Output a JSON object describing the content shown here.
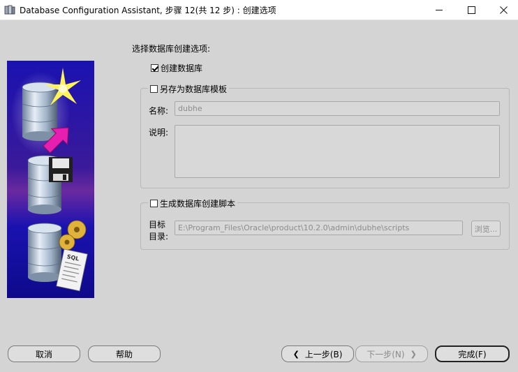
{
  "window": {
    "title": "Database Configuration Assistant, 步骤 12(共 12 步) : 创建选项",
    "minimize_glyph": "—",
    "maximize_glyph": "☐",
    "close_glyph": "✕"
  },
  "main": {
    "heading": "选择数据库创建选项:",
    "create_database": {
      "label": "创建数据库",
      "checked": true
    },
    "save_template": {
      "label": "另存为数据库模板",
      "checked": false,
      "name_label": "名称:",
      "name_value": "dubhe",
      "desc_label": "说明:",
      "desc_value": ""
    },
    "generate_scripts": {
      "label": "生成数据库创建脚本",
      "checked": false,
      "dest_label_1": "目标",
      "dest_label_2": "目录:",
      "dest_value": "E:\\Program_Files\\Oracle\\product\\10.2.0\\admin\\dubhe\\scripts",
      "browse_label": "浏览..."
    }
  },
  "footer": {
    "cancel": "取消",
    "help": "帮助",
    "back": "上一步(B)",
    "next": "下一步(N)",
    "finish": "完成(F)"
  },
  "colors": {
    "banner_bg": "#1d13a8",
    "accent_pink": "#e61fb0",
    "dialog_bg": "#d4d4d4"
  }
}
